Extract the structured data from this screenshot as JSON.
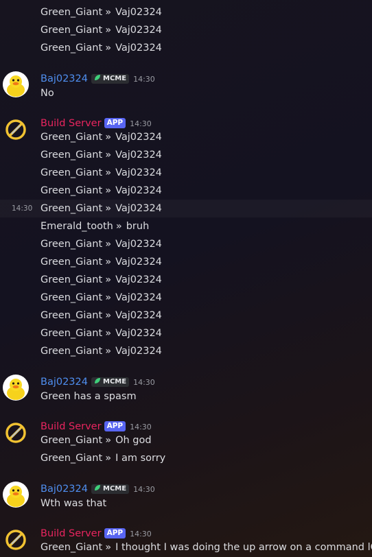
{
  "colors": {
    "baj_name": "#4f8ff0",
    "build_name": "#e9255f",
    "app_badge": "#5865f2",
    "mcme_leaf": "#3fcf7a"
  },
  "labels": {
    "baj": "Baj02324",
    "build": "Build Server",
    "app": "APP",
    "mcme": "MCME",
    "sep": "»"
  },
  "messages": {
    "top": [
      {
        "who": "Green_Giant",
        "text": "Vaj02324"
      },
      {
        "who": "Green_Giant",
        "text": "Vaj02324"
      },
      {
        "who": "Green_Giant",
        "text": "Vaj02324"
      }
    ],
    "g1": {
      "time": "14:30",
      "text": "No"
    },
    "g2": {
      "time": "14:30",
      "hover_time": "14:30",
      "lines": [
        {
          "who": "Green_Giant",
          "text": "Vaj02324"
        },
        {
          "who": "Green_Giant",
          "text": "Vaj02324"
        },
        {
          "who": "Green_Giant",
          "text": "Vaj02324"
        },
        {
          "who": "Green_Giant",
          "text": "Vaj02324"
        },
        {
          "who": "Green_Giant",
          "text": "Vaj02324"
        },
        {
          "who": "Emerald_tooth",
          "text": "bruh"
        },
        {
          "who": "Green_Giant",
          "text": "Vaj02324"
        },
        {
          "who": "Green_Giant",
          "text": "Vaj02324"
        },
        {
          "who": "Green_Giant",
          "text": "Vaj02324"
        },
        {
          "who": "Green_Giant",
          "text": "Vaj02324"
        },
        {
          "who": "Green_Giant",
          "text": "Vaj02324"
        },
        {
          "who": "Green_Giant",
          "text": "Vaj02324"
        },
        {
          "who": "Green_Giant",
          "text": "Vaj02324"
        }
      ]
    },
    "g3": {
      "time": "14:30",
      "text": "Green has a spasm"
    },
    "g4": {
      "time": "14:30",
      "lines": [
        {
          "who": "Green_Giant",
          "text": "Oh god"
        },
        {
          "who": "Green_Giant",
          "text": "I am sorry"
        }
      ]
    },
    "g5": {
      "time": "14:30",
      "text": "Wth was that"
    },
    "g6": {
      "time": "14:30",
      "lines": [
        {
          "who": "Green_Giant",
          "text": "I thought I was doing the up arrow on a command lOL"
        }
      ]
    }
  }
}
